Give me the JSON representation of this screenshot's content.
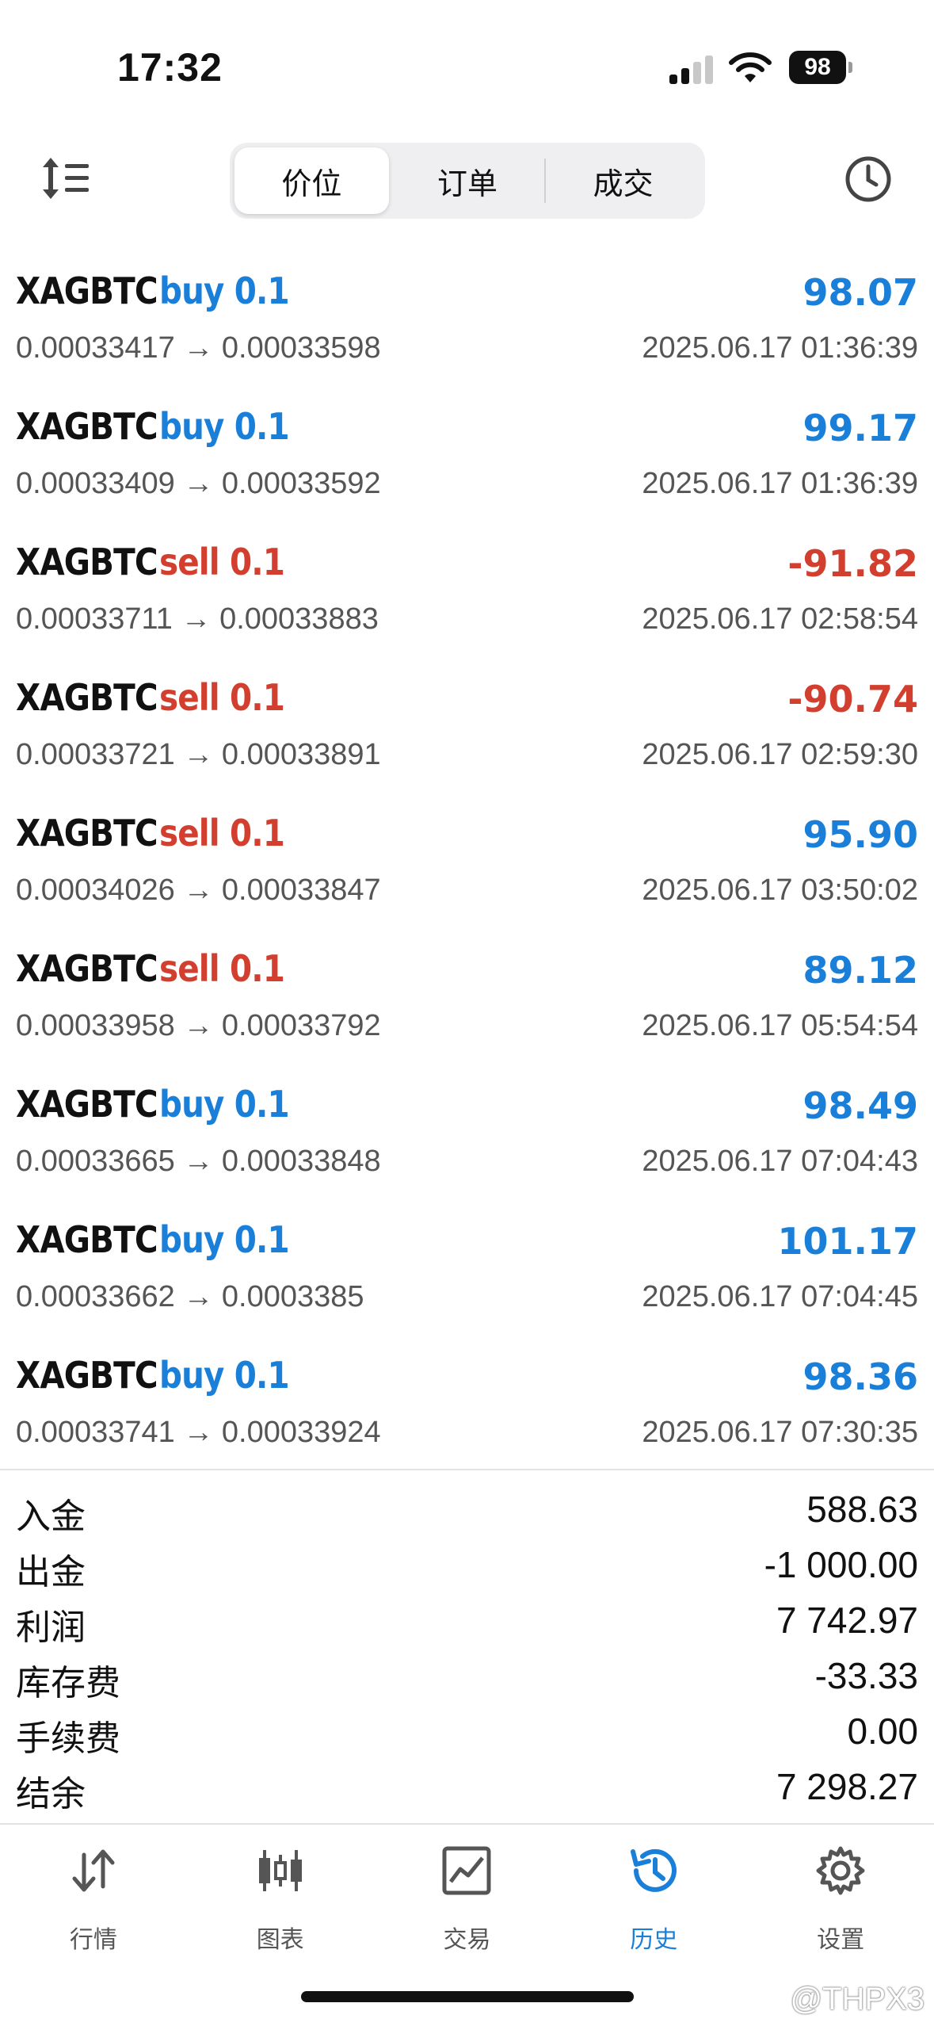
{
  "status_bar": {
    "time": "17:32",
    "battery": "98"
  },
  "header": {
    "segments": [
      "价位",
      "订单",
      "成交"
    ],
    "active_segment": 0
  },
  "trades": [
    {
      "symbol": "XAGBTC",
      "side": "buy 0.1",
      "profit": "98.07",
      "open": "0.00033417",
      "close": "0.00033598",
      "time": "2025.06.17 01:36:39"
    },
    {
      "symbol": "XAGBTC",
      "side": "buy 0.1",
      "profit": "99.17",
      "open": "0.00033409",
      "close": "0.00033592",
      "time": "2025.06.17 01:36:39"
    },
    {
      "symbol": "XAGBTC",
      "side": "sell 0.1",
      "profit": "-91.82",
      "open": "0.00033711",
      "close": "0.00033883",
      "time": "2025.06.17 02:58:54"
    },
    {
      "symbol": "XAGBTC",
      "side": "sell 0.1",
      "profit": "-90.74",
      "open": "0.00033721",
      "close": "0.00033891",
      "time": "2025.06.17 02:59:30"
    },
    {
      "symbol": "XAGBTC",
      "side": "sell 0.1",
      "profit": "95.90",
      "open": "0.00034026",
      "close": "0.00033847",
      "time": "2025.06.17 03:50:02"
    },
    {
      "symbol": "XAGBTC",
      "side": "sell 0.1",
      "profit": "89.12",
      "open": "0.00033958",
      "close": "0.00033792",
      "time": "2025.06.17 05:54:54"
    },
    {
      "symbol": "XAGBTC",
      "side": "buy 0.1",
      "profit": "98.49",
      "open": "0.00033665",
      "close": "0.00033848",
      "time": "2025.06.17 07:04:43"
    },
    {
      "symbol": "XAGBTC",
      "side": "buy 0.1",
      "profit": "101.17",
      "open": "0.00033662",
      "close": "0.0003385",
      "time": "2025.06.17 07:04:45"
    },
    {
      "symbol": "XAGBTC",
      "side": "buy 0.1",
      "profit": "98.36",
      "open": "0.00033741",
      "close": "0.00033924",
      "time": "2025.06.17 07:30:35"
    }
  ],
  "arrow": "→",
  "summary": [
    {
      "label": "入金",
      "value": "588.63"
    },
    {
      "label": "出金",
      "value": "-1 000.00"
    },
    {
      "label": "利润",
      "value": "7 742.97"
    },
    {
      "label": "库存费",
      "value": "-33.33"
    },
    {
      "label": "手续费",
      "value": "0.00"
    },
    {
      "label": "结余",
      "value": "7 298.27"
    }
  ],
  "tabs": [
    {
      "label": "行情",
      "icon": "quotes-arrows-icon"
    },
    {
      "label": "图表",
      "icon": "candlestick-chart-icon"
    },
    {
      "label": "交易",
      "icon": "trade-line-chart-icon"
    },
    {
      "label": "历史",
      "icon": "history-clock-icon"
    },
    {
      "label": "设置",
      "icon": "settings-gear-icon"
    }
  ],
  "active_tab": 3,
  "watermark": "@THPX3",
  "colors": {
    "buy": "#1a7fd8",
    "sell": "#d23f2f",
    "accent": "#1a7fd8"
  }
}
